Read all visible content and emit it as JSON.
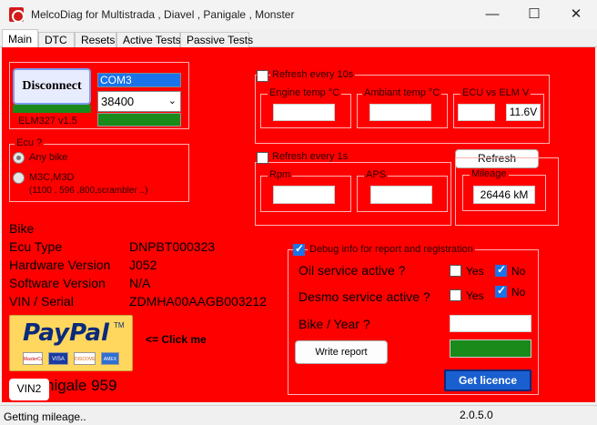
{
  "window": {
    "title": "MelcoDiag for Multistrada , Diavel , Panigale , Monster",
    "minimize": "—",
    "maximize": "☐",
    "close": "✕"
  },
  "tabs": [
    "Main",
    "DTC",
    "Resets",
    "Active Tests",
    "Passive Tests"
  ],
  "connection": {
    "disconnect_label": "Disconnect",
    "port": "COM3",
    "baud": "38400",
    "adapter": "ELM327 v1.5",
    "status_color": "#1a8a1a"
  },
  "ecu_group": {
    "title": "Ecu ?",
    "options": [
      "Any bike",
      "M3C,M3D",
      "(1100 , 596 ,800,scrambler ..)"
    ]
  },
  "refresh10": {
    "label": "Refresh every 10s",
    "engine_temp_label": "Engine temp °C",
    "ambiant_temp_label": "Ambiant temp °C",
    "ecu_elm_label": "ECU vs ELM V",
    "elm_voltage": "11.6V"
  },
  "refresh1": {
    "label": "Refresh every 1s",
    "rpm_label": "Rpm",
    "aps_label": "APS"
  },
  "mileage": {
    "refresh_label": "Refresh",
    "title": "Mileage",
    "value": "26446 kM"
  },
  "bike": {
    "heading": "Bike",
    "rows": [
      {
        "label": "Ecu Type",
        "value": "DNPBT000323"
      },
      {
        "label": "Hardware Version",
        "value": "J052"
      },
      {
        "label": "Software Version",
        "value": "N/A"
      },
      {
        "label": "VIN / Serial",
        "value": "ZDMHA00AAGB003212"
      }
    ],
    "model": "nigale 959",
    "vin2_label": "VIN2"
  },
  "paypal": {
    "brand": "PayPal",
    "tm": "TM",
    "cards": [
      "MasterCard",
      "VISA",
      "DISCOVER",
      "AMEX"
    ],
    "click_me": "<= Click me"
  },
  "debug": {
    "label": "Debug info for report and registration",
    "oil_label": "Oil service active ?",
    "desmo_label": "Desmo service active ?",
    "yes": "Yes",
    "no": "No",
    "bike_year_label": "Bike / Year ?",
    "write_report": "Write report",
    "get_licence": "Get licence",
    "licence_color": "#1a8a1a"
  },
  "status": {
    "message": "Getting mileage..",
    "version": "2.0.5.0"
  }
}
